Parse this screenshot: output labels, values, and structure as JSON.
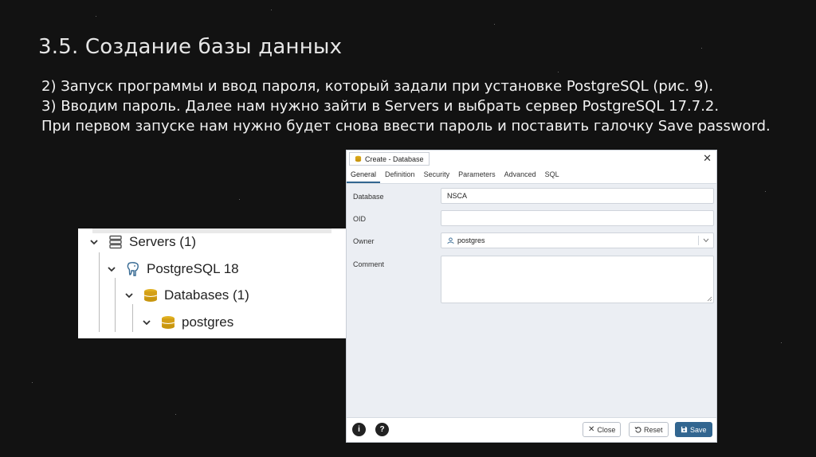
{
  "slide": {
    "title": "3.5. Создание базы данных",
    "lines": [
      "2) Запуск программы и ввод пароля, который задали при установке PostgreSQL (рис. 9).",
      "3) Вводим пароль. Далее нам нужно зайти в Servers и выбрать сервер PostgreSQL 17.7.2.",
      "При первом запуске нам нужно будет снова ввести пароль и поставить галочку Save password."
    ]
  },
  "tree": {
    "items": [
      {
        "label": "Servers (1)",
        "icon": "servers-icon"
      },
      {
        "label": "PostgreSQL 18",
        "icon": "elephant-icon"
      },
      {
        "label": "Databases (1)",
        "icon": "databases-icon"
      },
      {
        "label": "postgres",
        "icon": "database-icon"
      }
    ]
  },
  "dialog": {
    "title": "Create - Database",
    "tabs": [
      "General",
      "Definition",
      "Security",
      "Parameters",
      "Advanced",
      "SQL"
    ],
    "active_tab": "General",
    "fields": {
      "database_label": "Database",
      "database_value": "NSCA",
      "oid_label": "OID",
      "oid_value": "",
      "owner_label": "Owner",
      "owner_value": "postgres",
      "comment_label": "Comment",
      "comment_value": ""
    },
    "footer": {
      "info_label": "i",
      "help_label": "?",
      "close_label": "Close",
      "reset_label": "Reset",
      "save_label": "Save"
    },
    "colors": {
      "primary": "#326690",
      "background": "#ebeef3"
    }
  }
}
